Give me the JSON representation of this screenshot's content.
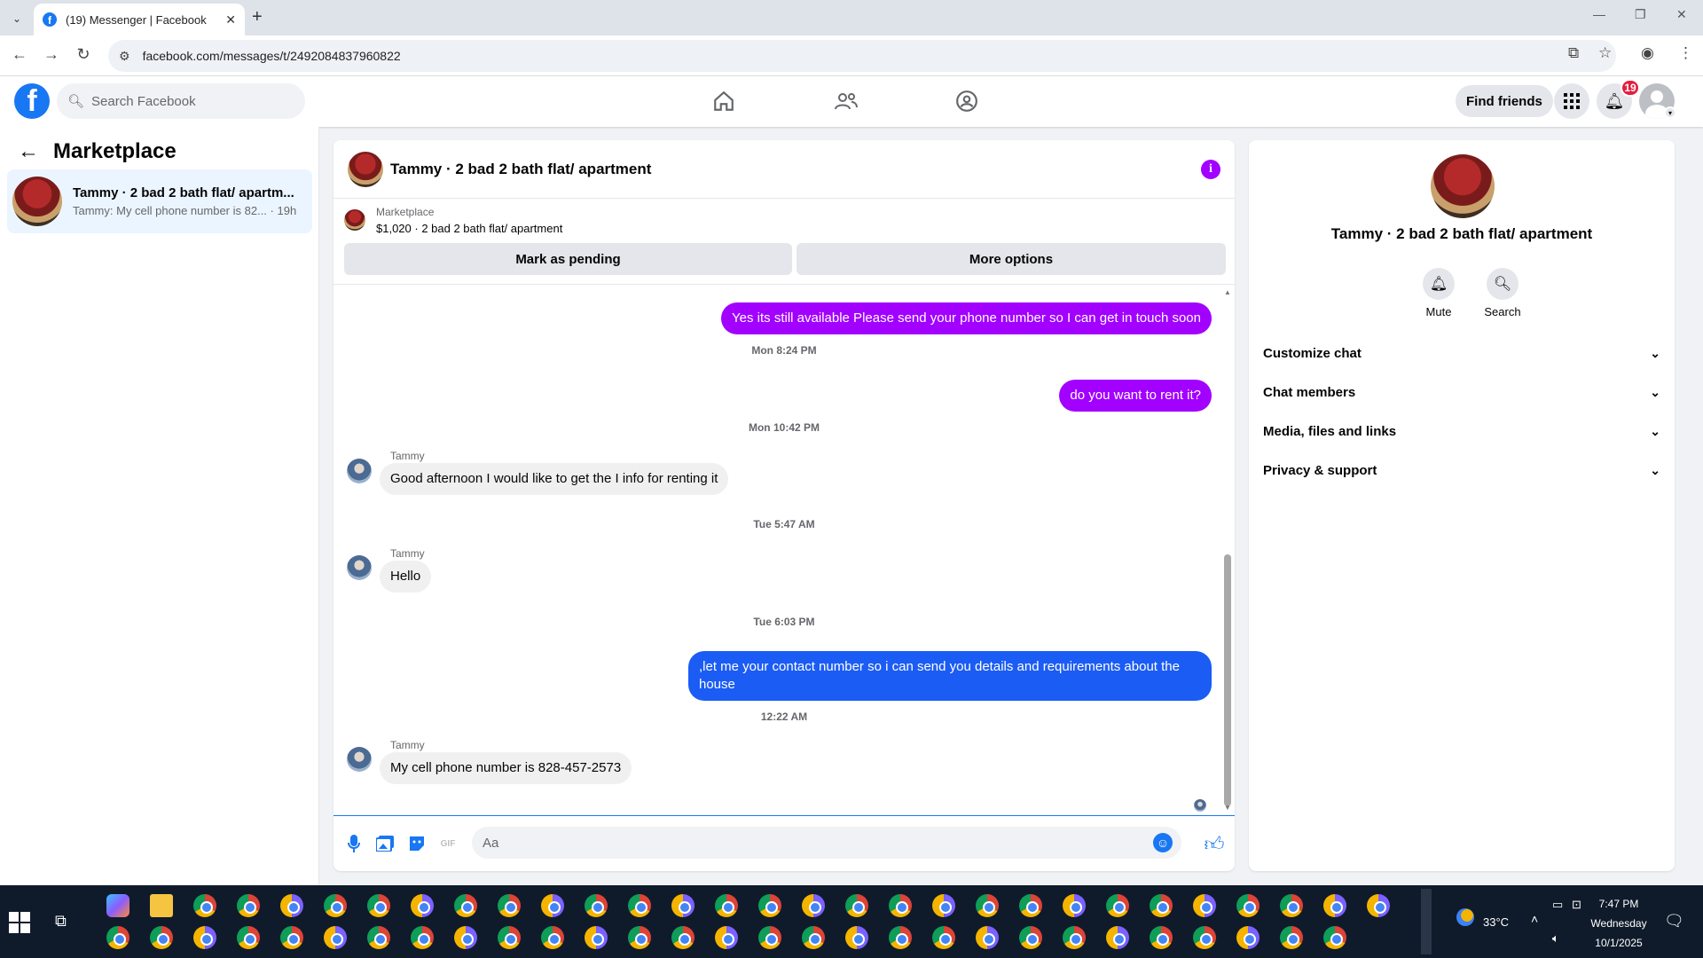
{
  "browser": {
    "tab_title": "(19) Messenger | Facebook",
    "url": "facebook.com/messages/t/2492084837960822",
    "icons": [
      "tab-list-icon",
      "close-tab-icon",
      "new-tab-icon",
      "minimize-icon",
      "restore-icon",
      "close-window-icon",
      "back-icon",
      "forward-icon",
      "reload-icon",
      "site-info-icon",
      "install-icon",
      "bookmark-star-icon",
      "profile-icon",
      "menu-icon"
    ]
  },
  "fb": {
    "search_placeholder": "Search Facebook",
    "find_friends": "Find friends",
    "notification_count": "19"
  },
  "left": {
    "title": "Marketplace",
    "conversation": {
      "title": "Tammy · 2 bad 2 bath flat/ apartm...",
      "snippet": "Tammy: My cell phone number is 82...",
      "time": "· 19h"
    }
  },
  "chat": {
    "header_name": "Tammy · 2 bad 2 bath flat/ apartment",
    "listing_label": "Marketplace",
    "listing_price": "$1,020 · 2 bad 2 bath flat/ apartment",
    "mark_pending": "Mark as pending",
    "more_options": "More options",
    "messages": {
      "out1": "Yes its still available Please send your phone number so I can get in touch soon",
      "ts1": "Mon 8:24 PM",
      "out2": "do you want to rent it?",
      "ts2": "Mon 10:42 PM",
      "sender1": "Tammy",
      "in1": "Good afternoon I would like to get the I info for renting it",
      "ts3": "Tue 5:47 AM",
      "sender2": "Tammy",
      "in2": "Hello",
      "ts4": "Tue 6:03 PM",
      "out3": ",let me your contact number so i can send you details and requirements about the house",
      "ts5": "12:22 AM",
      "sender3": "Tammy",
      "in3": "My cell phone number is 828-457-2573"
    },
    "composer_placeholder": "Aa"
  },
  "right": {
    "name": "Tammy · 2 bad 2 bath flat/ apartment",
    "mute": "Mute",
    "search": "Search",
    "items": [
      "Customize chat",
      "Chat members",
      "Media, files and links",
      "Privacy & support"
    ]
  },
  "taskbar": {
    "temperature": "33°C",
    "time": "7:47 PM",
    "day": "Wednesday",
    "date": "10/1/2025"
  },
  "colors": {
    "accent": "#1877f2",
    "outgoing_purple": "#a200ff",
    "outgoing_blue": "#1b5cf5"
  }
}
